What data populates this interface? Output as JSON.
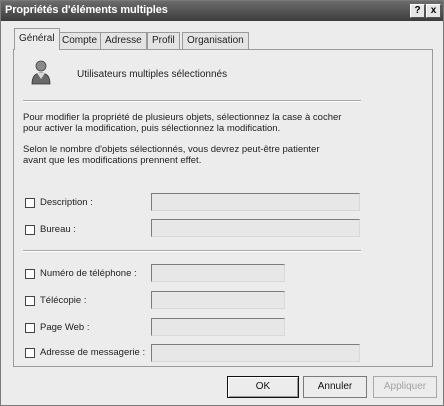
{
  "window": {
    "title": "Propriétés d'éléments multiples",
    "help_label": "?",
    "close_label": "x"
  },
  "tabs": [
    {
      "label": "Général",
      "active": true
    },
    {
      "label": "Compte",
      "active": false
    },
    {
      "label": "Adresse",
      "active": false
    },
    {
      "label": "Profil",
      "active": false
    },
    {
      "label": "Organisation",
      "active": false
    }
  ],
  "header": {
    "icon": "users-icon",
    "text": "Utilisateurs multiples sélectionnés"
  },
  "info": {
    "line1": "Pour modifier la propriété de plusieurs objets, sélectionnez la case à cocher",
    "line2": "pour activer la modification, puis sélectionnez la modification.",
    "line3": "Selon le nombre d'objets sélectionnés, vous devrez peut-être patienter",
    "line4": "avant que les modifications prennent effet."
  },
  "fields": {
    "description": {
      "label": "Description :",
      "checked": false,
      "value": ""
    },
    "bureau": {
      "label": "Bureau :",
      "checked": false,
      "value": ""
    },
    "telephone": {
      "label": "Numéro de téléphone :",
      "checked": false,
      "value": ""
    },
    "telecopie": {
      "label": "Télécopie :",
      "checked": false,
      "value": ""
    },
    "page_web": {
      "label": "Page Web :",
      "checked": false,
      "value": ""
    },
    "messagerie": {
      "label": "Adresse de messagerie :",
      "checked": false,
      "value": ""
    }
  },
  "buttons": {
    "ok": "OK",
    "cancel": "Annuler",
    "apply": "Appliquer"
  },
  "colors": {
    "titlebar": "#4a4a4a",
    "dialog_bg": "#ececec",
    "disabled_text": "#a2a2a2"
  }
}
